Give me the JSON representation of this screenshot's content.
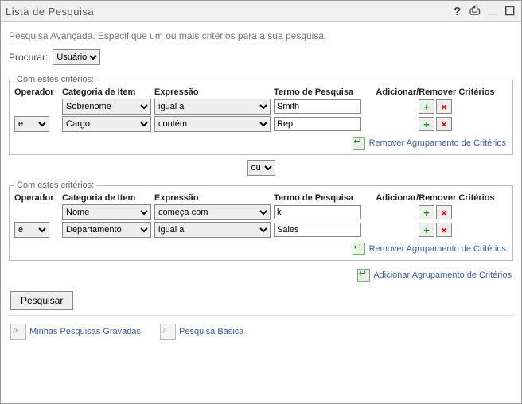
{
  "title": "Lista de Pesquisa",
  "subtitle": "Pesquisa Avançada. Especifique um ou mais critérios para a sua pesquisa.",
  "procurar": {
    "label": "Procurar:",
    "value": "Usuário"
  },
  "group_legend": "Com estes critérios:",
  "columns": {
    "operator": "Operador",
    "category": "Categoria de Item",
    "expression": "Expressão",
    "term": "Termo de Pesquisa",
    "actions": "Adicionar/Remover Critérios"
  },
  "groups": [
    {
      "rows": [
        {
          "operator": "",
          "category": "Sobrenome",
          "expression": "igual a",
          "term": "Smith"
        },
        {
          "operator": "e",
          "category": "Cargo",
          "expression": "contém",
          "term": "Rep"
        }
      ]
    },
    {
      "rows": [
        {
          "operator": "",
          "category": "Nome",
          "expression": "começa com",
          "term": "k"
        },
        {
          "operator": "e",
          "category": "Departamento",
          "expression": "igual a",
          "term": "Sales"
        }
      ]
    }
  ],
  "between_operator": "ou",
  "links": {
    "remove_group": "Remover Agrupamento de Critérios",
    "add_group": "Adicionar Agrupamento de Critérios"
  },
  "buttons": {
    "search": "Pesquisar"
  },
  "footer": {
    "saved": "Minhas Pesquisas Gravadas",
    "basic": "Pesquisa Básica"
  }
}
